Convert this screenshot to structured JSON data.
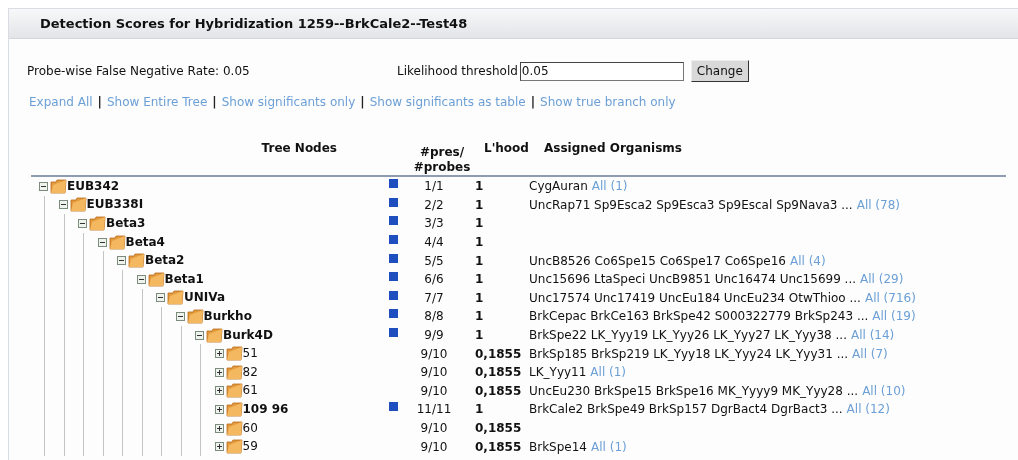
{
  "panel": {
    "title": "Detection Scores for Hybridization 1259--BrkCale2--Test48"
  },
  "settings": {
    "fnr_label": "Probe-wise False Negative Rate: 0.05",
    "threshold_label": "Likelihood threshold",
    "threshold_value": "0.05",
    "button": "Change"
  },
  "links": [
    "Expand All",
    "Show Entire Tree",
    "Show significants only",
    "Show significants as table",
    "Show true branch only"
  ],
  "link_separator": "|",
  "table": {
    "columns": [
      "Tree Nodes",
      "#pres/ #probes",
      "L'hood",
      "Assigned Organisms"
    ],
    "tree": [
      {
        "name": "EUB342",
        "expanded": true,
        "significant": true,
        "pres": "1/1",
        "lhood": "1",
        "organisms": "CygAuran",
        "all": "All (1)",
        "children": [
          {
            "name": "EUB338I",
            "expanded": true,
            "significant": true,
            "pres": "2/2",
            "lhood": "1",
            "organisms": "UncRap71 Sp9Esca2 Sp9Esca3 Sp9Escal Sp9Nava3 ...",
            "all": "All (78)",
            "children": [
              {
                "name": "Beta3",
                "expanded": true,
                "significant": true,
                "pres": "3/3",
                "lhood": "1",
                "children": [
                  {
                    "name": "Beta4",
                    "expanded": true,
                    "significant": true,
                    "pres": "4/4",
                    "lhood": "1",
                    "children": [
                      {
                        "name": "Beta2",
                        "expanded": true,
                        "significant": true,
                        "pres": "5/5",
                        "lhood": "1",
                        "organisms": "UncB8526 Co6Spe15 Co6Spe17 Co6Spe16",
                        "all": "All (4)",
                        "children": [
                          {
                            "name": "Beta1",
                            "expanded": true,
                            "significant": true,
                            "pres": "6/6",
                            "lhood": "1",
                            "organisms": "Unc15696 LtaSpeci UncB9851 Unc16474 Unc15699 ...",
                            "all": "All (29)",
                            "children": [
                              {
                                "name": "UNIVa",
                                "expanded": true,
                                "significant": true,
                                "pres": "7/7",
                                "lhood": "1",
                                "organisms": "Unc17574 Unc17419 UncEu184 UncEu234 OtwThioo ...",
                                "all": "All (716)",
                                "children": [
                                  {
                                    "name": "Burkho",
                                    "expanded": true,
                                    "significant": true,
                                    "pres": "8/8",
                                    "lhood": "1",
                                    "organisms": "BrkCepac BrkCe163 BrkSpe42 S000322779 BrkSp243 ...",
                                    "all": "All (19)",
                                    "children": [
                                      {
                                        "name": "Burk4D",
                                        "expanded": true,
                                        "significant": true,
                                        "pres": "9/9",
                                        "lhood": "1",
                                        "organisms": "BrkSpe22 LK_Yyy19 LK_Yyy26 LK_Yyy27 LK_Yyy38 ...",
                                        "all": "All (14)",
                                        "children": [
                                          {
                                            "name": "51",
                                            "expanded": false,
                                            "significant": false,
                                            "pres": "9/10",
                                            "lhood": "0,1855",
                                            "organisms": "BrkSp185 BrkSp219 LK_Yyy18 LK_Yyy24 LK_Yyy31 ...",
                                            "all": "All (7)"
                                          },
                                          {
                                            "name": "82",
                                            "expanded": false,
                                            "significant": false,
                                            "pres": "9/10",
                                            "lhood": "0,1855",
                                            "organisms": "LK_Yyy11",
                                            "all": "All (1)"
                                          },
                                          {
                                            "name": "61",
                                            "expanded": false,
                                            "significant": false,
                                            "pres": "9/10",
                                            "lhood": "0,1855",
                                            "organisms": "UncEu230 BrkSpe15 BrkSpe16 MK_Yyyy9 MK_Yyy28 ...",
                                            "all": "All (10)"
                                          },
                                          {
                                            "name": "109 96",
                                            "expanded": false,
                                            "significant": true,
                                            "pres": "11/11",
                                            "lhood": "1",
                                            "organisms": "BrkCale2 BrkSpe49 BrkSp157 DgrBact4 DgrBact3 ...",
                                            "all": "All (12)"
                                          },
                                          {
                                            "name": "60",
                                            "expanded": false,
                                            "significant": false,
                                            "pres": "9/10",
                                            "lhood": "0,1855"
                                          },
                                          {
                                            "name": "59",
                                            "expanded": false,
                                            "significant": false,
                                            "pres": "9/10",
                                            "lhood": "0,1855",
                                            "organisms": "BrkSpe14",
                                            "all": "All (1)"
                                          }
                                        ]
                                      }
                                    ]
                                  }
                                ]
                              }
                            ]
                          }
                        ]
                      }
                    ]
                  }
                ]
              }
            ]
          }
        ]
      }
    ]
  }
}
